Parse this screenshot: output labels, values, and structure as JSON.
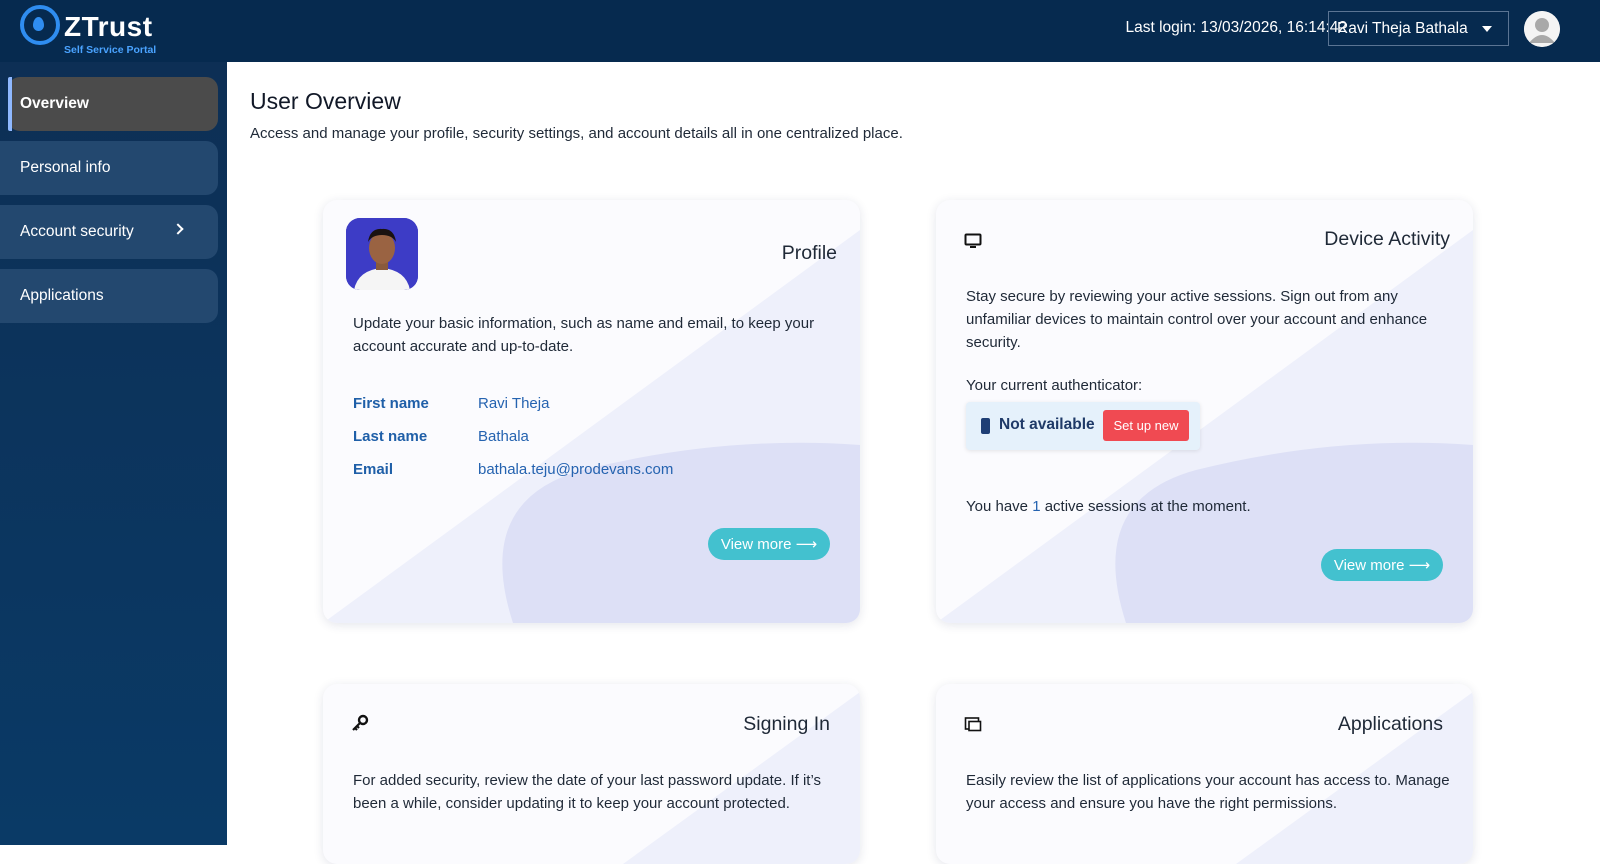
{
  "app": {
    "logo_text": "ZTrust",
    "logo_subtitle": "Self Service Portal"
  },
  "header": {
    "last_login": "Last login: 13/03/2026, 16:14:42",
    "user_name": "Ravi Theja Bathala"
  },
  "sidebar": {
    "items": [
      {
        "label": "Overview",
        "active": true
      },
      {
        "label": "Personal info"
      },
      {
        "label": "Account security",
        "has_submenu": true
      },
      {
        "label": "Applications"
      }
    ]
  },
  "main": {
    "title": "User Overview",
    "subtitle": "Access and manage your profile, security settings, and account details all in one centralized place."
  },
  "profile_card": {
    "title": "Profile",
    "description": "Update your basic information, such as name and email, to keep your account accurate and up-to-date.",
    "fields": [
      {
        "label": "First name",
        "value": "Ravi Theja"
      },
      {
        "label": "Last name",
        "value": "Bathala"
      },
      {
        "label": "Email",
        "value": "bathala.teju@prodevans.com"
      }
    ],
    "button": "View more ⟶"
  },
  "device_card": {
    "title": "Device Activity",
    "description": "Stay secure by reviewing your active sessions. Sign out from any unfamiliar devices to maintain control over your account and enhance security.",
    "authenticator_label": "Your current authenticator:",
    "authenticator_status": "Not available",
    "setup_button": "Set up new",
    "sessions_prefix": "You have ",
    "sessions_count": "1",
    "sessions_suffix": " active sessions at the moment.",
    "button": "View more ⟶"
  },
  "signing_card": {
    "title": "Signing In",
    "description": "For added security, review the date of your last password update. If it’s been a while, consider updating it to keep your account protected."
  },
  "applications_card": {
    "title": "Applications",
    "description": "Easily review the list of applications your account has access to. Manage your access and ensure you have the right permissions."
  },
  "colors": {
    "header_bg": "#062a4f",
    "sidebar_bg": "#0d2f55",
    "accent_teal": "#43c1cf",
    "danger_red": "#f04a52",
    "link_blue": "#2563b0"
  },
  "icons": {
    "logo": "location-pin-icon",
    "user_menu": "chevron-down-icon",
    "avatar": "user-avatar-icon",
    "device": "monitor-icon",
    "authenticator": "phone-icon",
    "signing": "key-icon",
    "applications": "window-icon",
    "submenu": "chevron-right-icon"
  }
}
